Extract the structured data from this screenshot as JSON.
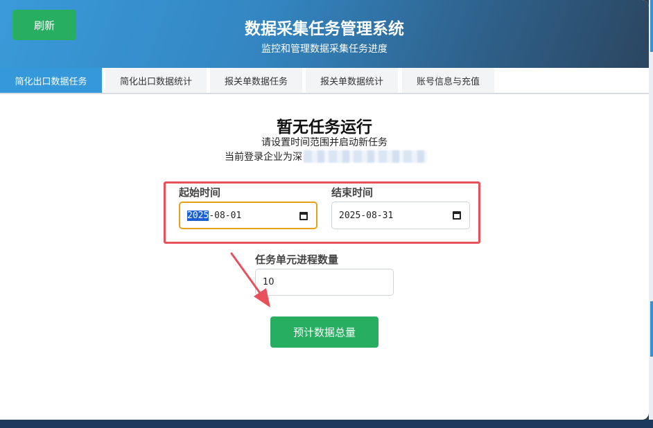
{
  "header": {
    "refresh_label": "刷新",
    "title": "数据采集任务管理系统",
    "subtitle": "监控和管理数据采集任务进度"
  },
  "tabs": [
    {
      "label": "简化出口数据任务",
      "active": true
    },
    {
      "label": "简化出口数据统计",
      "active": false
    },
    {
      "label": "报关单数据任务",
      "active": false
    },
    {
      "label": "报关单数据统计",
      "active": false
    },
    {
      "label": "账号信息与充值",
      "active": false
    }
  ],
  "main": {
    "empty_title": "暂无任务运行",
    "empty_subtitle": "请设置时间范围并启动新任务",
    "company_prefix": "当前登录企业为",
    "company_name_char": "深"
  },
  "form": {
    "start_label": "起始时间",
    "start_year": "2025",
    "start_rest": "-08-01",
    "end_label": "结束时间",
    "end_value": "2025-08-31",
    "workers_label": "任务单元进程数量",
    "workers_value": "10",
    "estimate_label": "预计数据总量"
  },
  "colors": {
    "accent": "#3498db",
    "success": "#27ae60",
    "annotation": "#e8505b",
    "focus": "#e3a21a"
  }
}
